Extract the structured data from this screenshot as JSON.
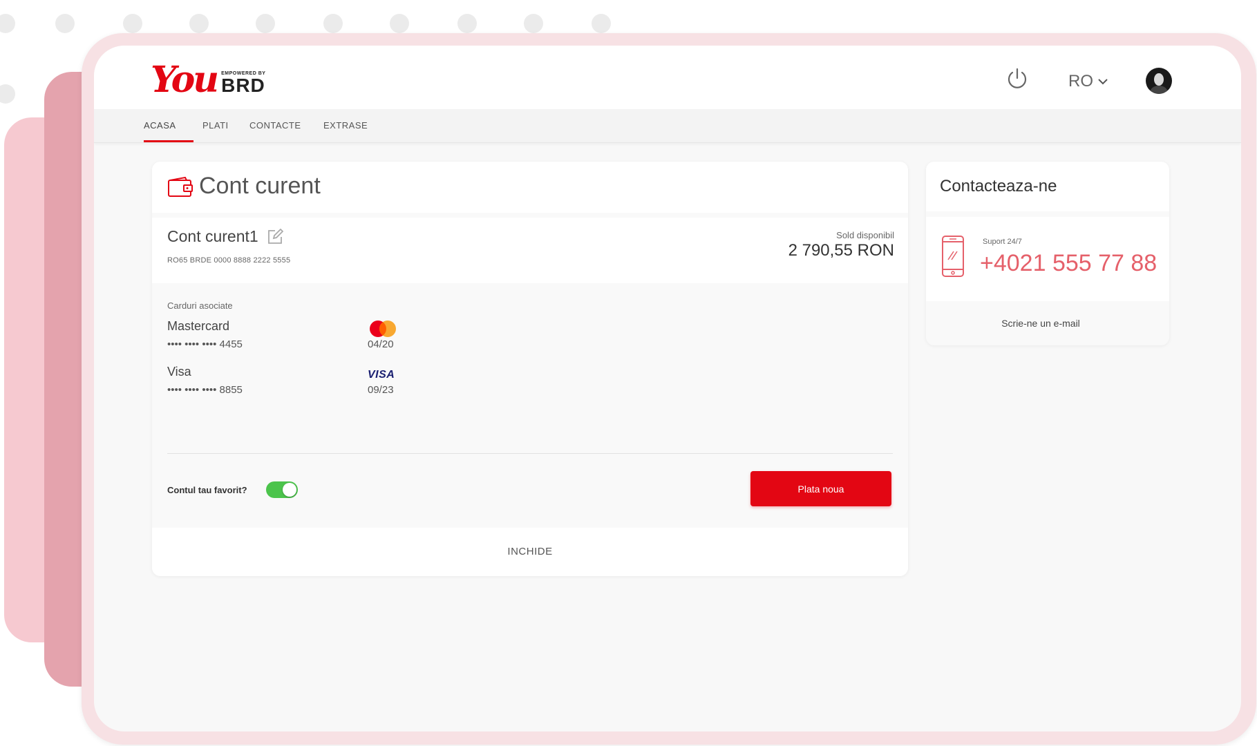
{
  "brand": {
    "logo_main": "You",
    "logo_tagline": "EMPOWERED BY",
    "logo_bank": "BRD",
    "accent_color": "#e30613"
  },
  "header": {
    "power_icon": "power-icon",
    "language": "RO",
    "language_icon": "chevron-down-icon",
    "avatar_icon": "user-avatar"
  },
  "nav": {
    "items": [
      {
        "label": "ACASA",
        "active": true
      },
      {
        "label": "PLATI",
        "active": false
      },
      {
        "label": "CONTACTE",
        "active": false
      },
      {
        "label": "EXTRASE",
        "active": false
      }
    ]
  },
  "account_card": {
    "title": "Cont curent",
    "title_icon": "wallet-icon",
    "account_name": "Cont curent1",
    "edit_icon": "edit-icon",
    "iban": "RO65 BRDE 0000 8888 2222 5555",
    "balance_label": "Sold disponibil",
    "balance": "2 790,55 RON",
    "cards_label": "Carduri asociate",
    "cards": [
      {
        "name": "Mastercard",
        "number": "•••• •••• •••• 4455",
        "expiry": "04/20",
        "logo": "mastercard-logo"
      },
      {
        "name": "Visa",
        "number": "•••• •••• ••••  8855",
        "expiry": "09/23",
        "logo": "VISA"
      }
    ],
    "favorite_label": "Contul tau favorit?",
    "favorite_on": true,
    "new_payment_button": "Plata noua",
    "close_label": "INCHIDE"
  },
  "contact_card": {
    "title": "Contacteaza-ne",
    "support_label": "Suport 24/7",
    "phone": "+4021 555 77 88",
    "phone_icon": "smartphone-icon",
    "email_link": "Scrie-ne un e-mail",
    "phone_color": "#e5606a"
  }
}
